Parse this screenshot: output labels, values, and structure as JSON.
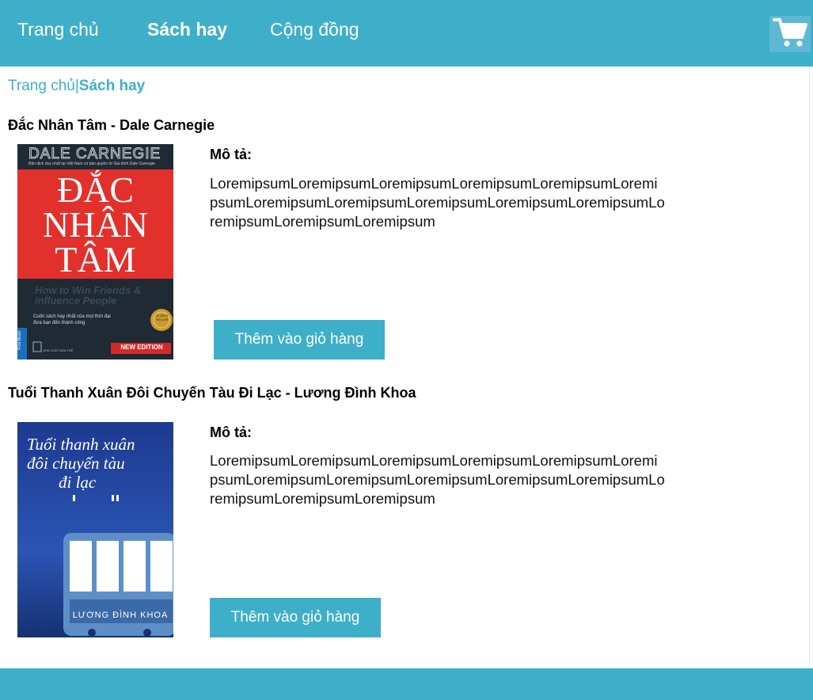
{
  "nav": {
    "items": [
      {
        "label": "Trang chủ"
      },
      {
        "label": "Sách hay"
      },
      {
        "label": "Cộng đồng"
      }
    ],
    "cart_icon": "shopping-cart-icon"
  },
  "breadcrumb": {
    "home": "Trang chủ",
    "separator": "|",
    "current": "Sách hay"
  },
  "books": [
    {
      "title": "Đắc Nhân Tâm - Dale Carnegie",
      "cover": {
        "author": "DALE CARNEGIE",
        "subtitle_small": "Bản dịch duy nhất tại Việt Nam có bản quyền từ Gia đình Dale Carnegie",
        "line1": "ĐẮC",
        "line2": "NHÂN",
        "line3": "TÂM",
        "english": "How to Win Friends & Influence People",
        "tagline": "Cuốn sách hay nhất của mọi thời đại đưa bạn đến thành công",
        "edition": "NEW EDITION",
        "seal": "#1 BEST SELLER",
        "spine": "First News",
        "publisher": "NHÀ XUẤT BẢN TRẺ"
      },
      "desc_label": "Mô tả:",
      "desc_text": "LoremipsumLoremipsumLoremipsumLoremipsumLoremipsumLoremipsumLoremipsumLoremipsumLoremipsumLoremipsumLoremipsumLoremipsumLoremipsumLoremipsum",
      "button": "Thêm vào giỏ hàng"
    },
    {
      "title": "Tuổi Thanh Xuân Đôi Chuyến Tàu Đi Lạc - Lương Đình Khoa",
      "cover": {
        "line1": "Tuổi thanh xuân",
        "line2": "đôi chuyến tàu",
        "line3": "đi lạc",
        "author": "LƯƠNG ĐÌNH KHOA"
      },
      "desc_label": "Mô tả:",
      "desc_text": "LoremipsumLoremipsumLoremipsumLoremipsumLoremipsumLoremipsumLoremipsumLoremipsumLoremipsumLoremipsumLoremipsumLoremipsumLoremipsumLoremipsum",
      "button": "Thêm vào giỏ hàng"
    }
  ],
  "colors": {
    "accent": "#3eafc9",
    "cover1_red": "#e2312c",
    "cover1_dark": "#1f2a35",
    "cover2_blue": "#1c3f9a"
  }
}
